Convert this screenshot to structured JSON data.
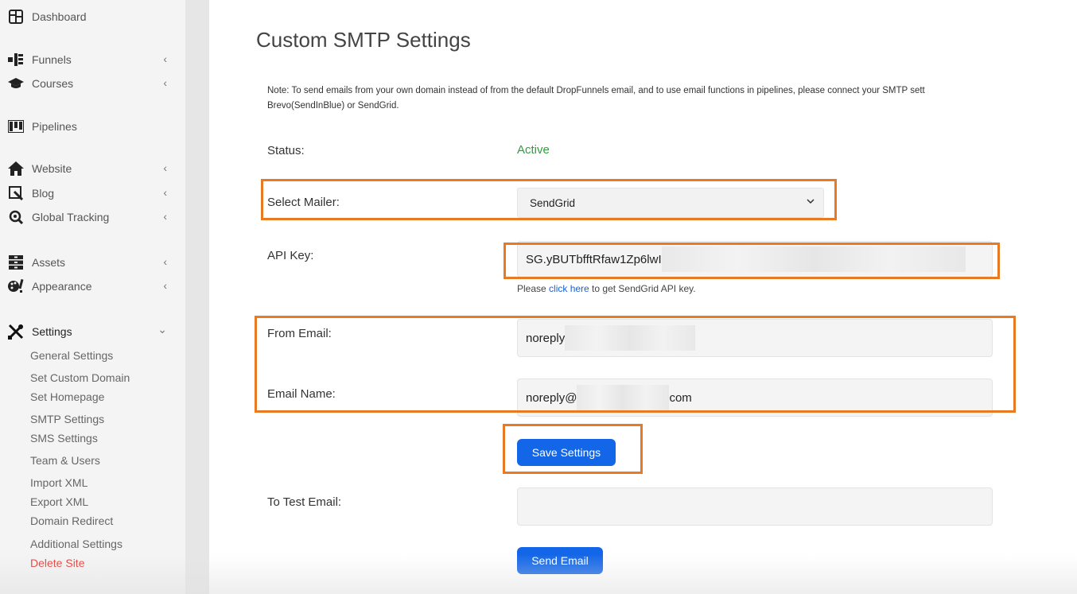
{
  "sidebar": {
    "items": [
      {
        "label": "Dashboard",
        "icon": "dashboard-icon"
      },
      {
        "label": "Funnels",
        "icon": "funnel-icon"
      },
      {
        "label": "Courses",
        "icon": "graduation-cap-icon"
      },
      {
        "label": "Pipelines",
        "icon": "pipeline-icon"
      },
      {
        "label": "Website",
        "icon": "home-icon"
      },
      {
        "label": "Blog",
        "icon": "blog-icon"
      },
      {
        "label": "Global Tracking",
        "icon": "tracking-icon"
      },
      {
        "label": "Assets",
        "icon": "assets-icon"
      },
      {
        "label": "Appearance",
        "icon": "appearance-icon"
      },
      {
        "label": "Settings",
        "icon": "tools-icon"
      }
    ],
    "settings_sub": [
      "General Settings",
      "Set Custom Domain",
      "Set Homepage",
      "SMTP Settings",
      "SMS Settings",
      "Team & Users",
      "Import XML",
      "Export XML",
      "Domain Redirect",
      "Additional Settings",
      "Delete Site"
    ]
  },
  "main": {
    "title": "Custom SMTP Settings",
    "note_line1": "Note: To send emails from your own domain instead of from the default DropFunnels email, and to use email functions in pipelines, please connect your SMTP sett",
    "note_line2": "Brevo(SendInBlue) or SendGrid.",
    "status_label": "Status:",
    "status_value": "Active",
    "mailer_label": "Select Mailer:",
    "mailer_value": "SendGrid",
    "api_key_label": "API Key:",
    "api_key_value": "SG.yBUTbfftRfaw1Zp6lwI",
    "help_prefix": "Please ",
    "help_link": "click here",
    "help_suffix": " to get SendGrid API key.",
    "from_email_label": "From Email:",
    "from_email_value": "noreply",
    "email_name_label": "Email Name:",
    "email_name_prefix": "noreply@",
    "email_name_suffix": "com",
    "save_button": "Save Settings",
    "test_email_label": "To Test Email:",
    "send_button": "Send Email"
  },
  "colors": {
    "accent": "#1366e8",
    "highlight": "#e77a22",
    "status_active": "#2e9e3f",
    "danger": "#e53935"
  }
}
